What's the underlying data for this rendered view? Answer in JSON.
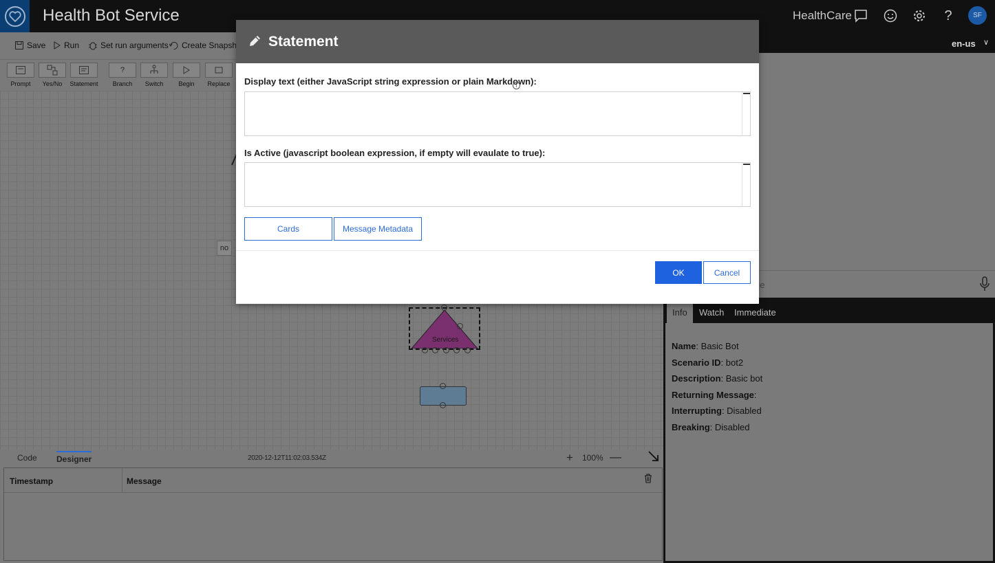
{
  "header": {
    "app_title": "Health Bot Service",
    "tenant": "HealthCare",
    "avatar_initials": "SF",
    "icons": [
      "heart-logo-icon",
      "chat-icon",
      "smiley-icon",
      "gear-icon",
      "help-icon"
    ]
  },
  "toolbar": {
    "save_label": "Save",
    "run_label": "Run",
    "run_args_label": "Set run arguments",
    "snapshot_label": "Create Snapshot"
  },
  "palette": {
    "items": [
      {
        "label": "Prompt"
      },
      {
        "label": "Yes/No"
      },
      {
        "label": "Statement"
      },
      {
        "label": "Branch"
      },
      {
        "label": "Switch"
      },
      {
        "label": "Begin"
      },
      {
        "label": "Replace"
      }
    ]
  },
  "canvas": {
    "no_chip": "no",
    "services_label": "Services"
  },
  "designer_tabs": {
    "code": "Code",
    "designer": "Designer",
    "timestamp": "2020-12-12T11:02:03.534Z",
    "zoom_plus": "+",
    "zoom_level": "100%",
    "zoom_minus": "—"
  },
  "log": {
    "col_timestamp": "Timestamp",
    "col_message": "Message"
  },
  "right_panel": {
    "language": "en-us",
    "chat_placeholder_visible": "ge",
    "tabs": [
      "Info",
      "Watch",
      "Immediate"
    ],
    "info": [
      {
        "key": "Name",
        "value": ": Basic Bot"
      },
      {
        "key": "Scenario ID",
        "value": ": bot2"
      },
      {
        "key": "Description",
        "value": ": Basic bot"
      },
      {
        "key": "Returning Message",
        "value": ":"
      },
      {
        "key": "Interrupting",
        "value": ": Disabled"
      },
      {
        "key": "Breaking",
        "value": ": Disabled"
      }
    ]
  },
  "dialog": {
    "title": "Statement",
    "display_text_label": "Display text (either JavaScript string expression or plain Markdown):",
    "display_text_value": "",
    "is_active_label": "Is Active (javascript boolean expression, if empty will evaulate to true):",
    "is_active_value": "",
    "cards_label": "Cards",
    "metadata_label": "Message Metadata",
    "ok_label": "OK",
    "cancel_label": "Cancel"
  },
  "colors": {
    "header_bg": "#111111",
    "accent_blue": "#1f62e0",
    "dialog_header": "#5a5a5a",
    "services_node": "#7a2f6e"
  }
}
